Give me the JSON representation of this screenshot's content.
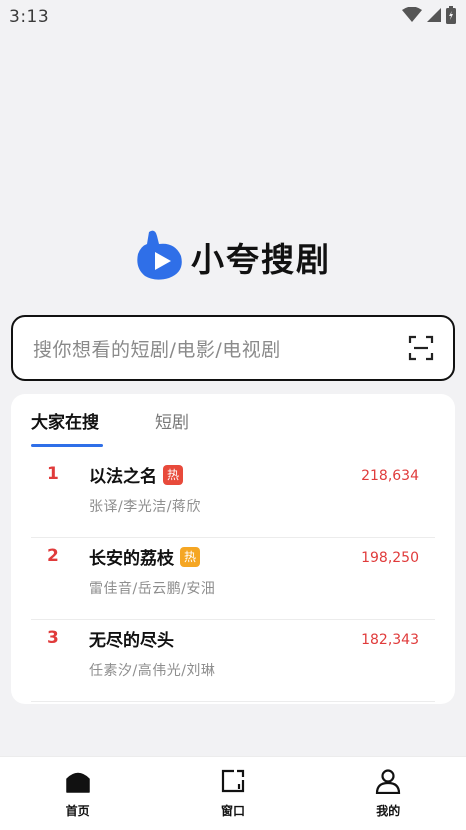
{
  "status_bar": {
    "time": "3:13"
  },
  "logo": {
    "text": "小夸搜剧",
    "accent": "#2f6fe8"
  },
  "search": {
    "placeholder": "搜你想看的短剧/电影/电视剧"
  },
  "tabs": [
    {
      "label": "大家在搜",
      "active": true
    },
    {
      "label": "短剧",
      "active": false
    }
  ],
  "trending": [
    {
      "rank": "1",
      "title": "以法之名",
      "badge": "热",
      "badge_color": "#e84a3b",
      "cast": "张译/李光洁/蒋欣",
      "count": "218,634"
    },
    {
      "rank": "2",
      "title": "长安的荔枝",
      "badge": "热",
      "badge_color": "#f5a623",
      "cast": "雷佳音/岳云鹏/安沺",
      "count": "198,250"
    },
    {
      "rank": "3",
      "title": "无尽的尽头",
      "badge": "",
      "badge_color": "",
      "cast": "任素汐/高伟光/刘琳",
      "count": "182,343"
    }
  ],
  "bottom_nav": [
    {
      "label": "首页",
      "icon": "home-icon"
    },
    {
      "label": "窗口",
      "icon": "window-icon"
    },
    {
      "label": "我的",
      "icon": "user-icon"
    }
  ]
}
